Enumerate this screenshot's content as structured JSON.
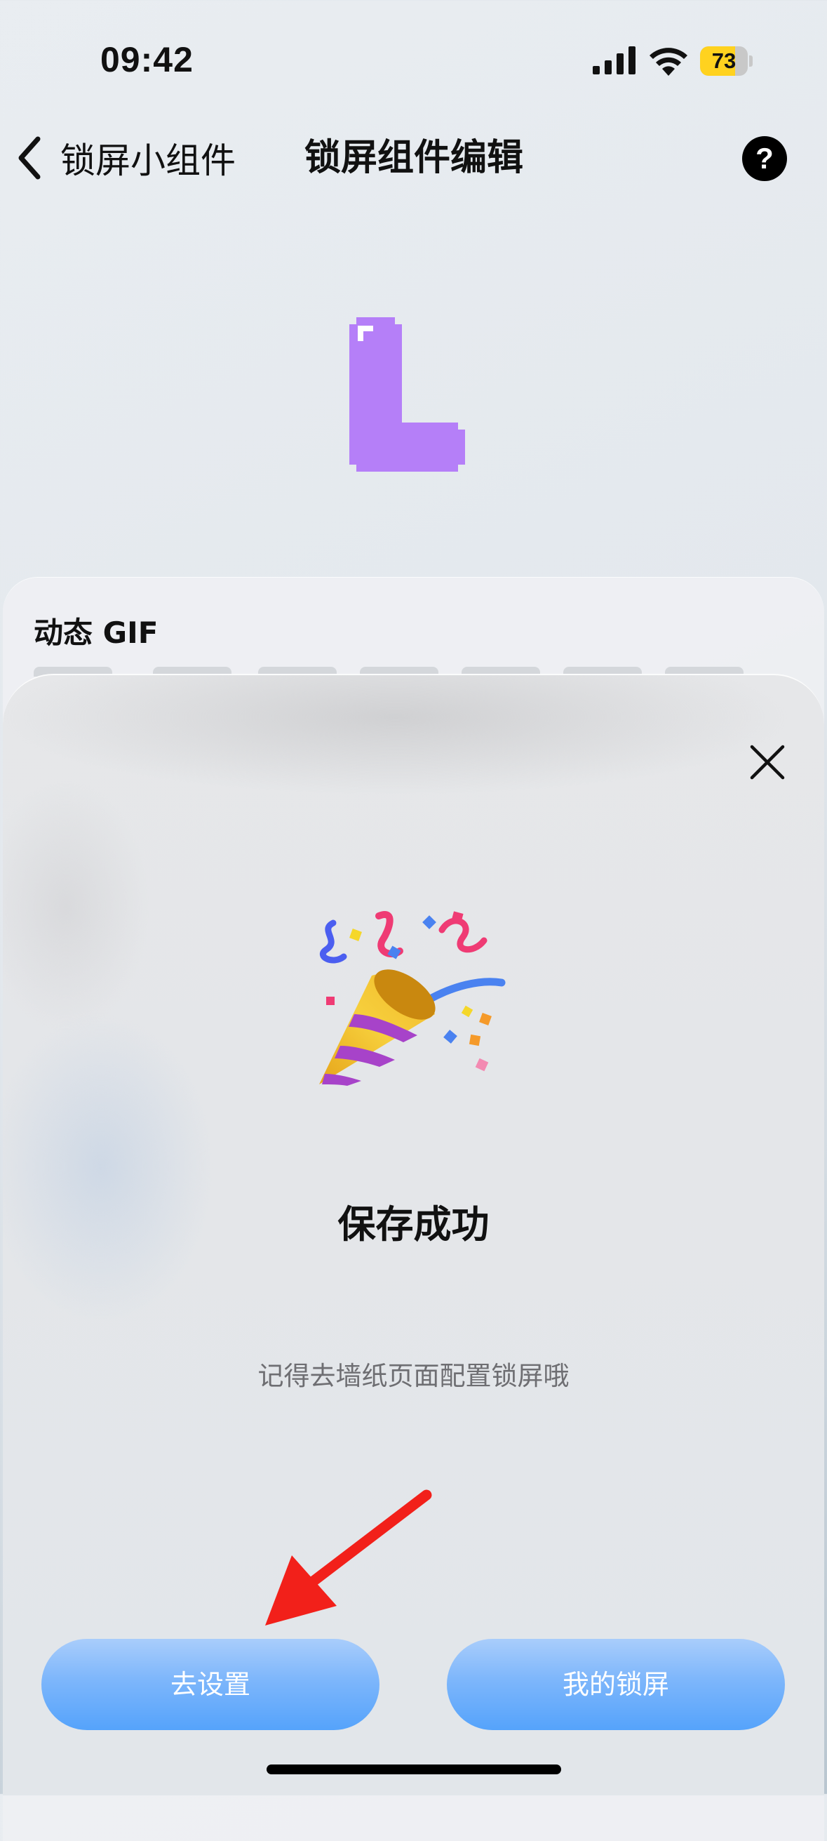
{
  "status_bar": {
    "time": "09:42",
    "battery": "73",
    "battery_level": 0.73
  },
  "nav": {
    "back_label": "锁屏小组件",
    "title": "锁屏组件编辑",
    "help_label": "?"
  },
  "panel": {
    "title": "动态 GIF"
  },
  "dialog": {
    "title": "保存成功",
    "subtitle": "记得去墙纸页面配置锁屏哦",
    "primary_button": "去设置",
    "secondary_button": "我的锁屏"
  },
  "colors": {
    "accent_blue": "#5aa6fb",
    "preview_purple": "#b57ff8",
    "battery_yellow": "#ffd21f",
    "arrow_red": "#f2201a"
  },
  "icons": {
    "back": "chevron-left-icon",
    "help": "question-icon",
    "close": "close-icon",
    "celebration": "party-popper-icon",
    "pointer": "red-arrow-icon"
  }
}
